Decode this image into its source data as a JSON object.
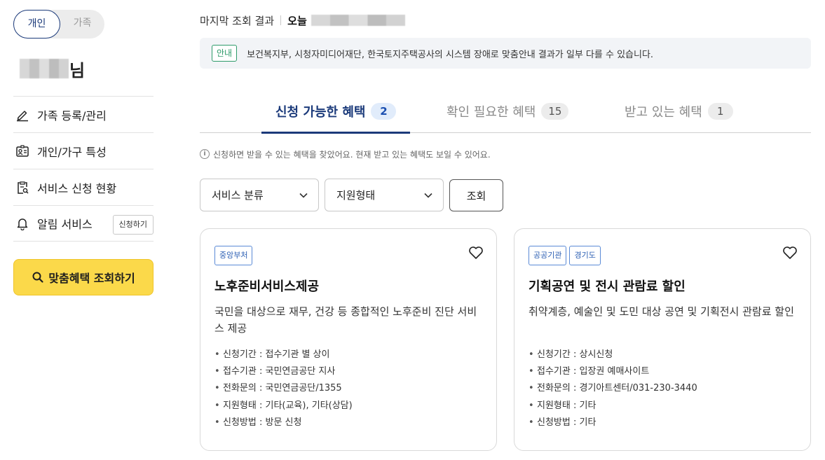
{
  "sidebar": {
    "toggle": {
      "personal": "개인",
      "family": "가족"
    },
    "user_suffix": "님",
    "menu": [
      {
        "label": "가족 등록/관리",
        "icon": "edit-pen-icon"
      },
      {
        "label": "개인/가구 특성",
        "icon": "id-card-icon"
      },
      {
        "label": "서비스 신청 현황",
        "icon": "clipboard-search-icon"
      },
      {
        "label": "알림 서비스",
        "icon": "bell-icon",
        "button": "신청하기"
      }
    ],
    "search_button": "맞춤혜택 조회하기"
  },
  "header": {
    "last_result": "마지막 조회 결과",
    "today": "오늘"
  },
  "notice": {
    "tag": "안내",
    "text": "보건복지부, 시청자미디어재단, 한국토지주택공사의 시스템 장애로 맞춤안내 결과가 일부 다를 수 있습니다."
  },
  "tabs": [
    {
      "label": "신청 가능한 혜택",
      "count": "2",
      "active": true
    },
    {
      "label": "확인 필요한 혜택",
      "count": "15",
      "active": false
    },
    {
      "label": "받고 있는 혜택",
      "count": "1",
      "active": false
    }
  ],
  "hint": "신청하면 받을 수 있는 혜택을 찾았어요. 현재 받고 있는 혜택도 보일 수 있어요.",
  "filters": {
    "category": "서비스 분류",
    "support_type": "지원형태",
    "query_button": "조회"
  },
  "cards": [
    {
      "badges": [
        "중앙부처"
      ],
      "title": "노후준비서비스제공",
      "desc": "국민을 대상으로 재무, 건강 등 종합적인 노후준비 진단 서비스 제공",
      "details": [
        "신청기간 : 접수기관 별 상이",
        "접수기관 : 국민연금공단 지사",
        "전화문의 : 국민연금공단/1355",
        "지원형태 : 기타(교육), 기타(상담)",
        "신청방법 : 방문 신청"
      ]
    },
    {
      "badges": [
        "공공기관",
        "경기도"
      ],
      "title": "기획공연 및 전시 관람료 할인",
      "desc": "취약계층, 예술인 및 도민 대상 공연 및 기획전시 관람료 할인",
      "details": [
        "신청기간 : 상시신청",
        "접수기관 : 입장권 예매사이트",
        "전화문의 : 경기아트센터/031-230-3440",
        "지원형태 : 기타",
        "신청방법 : 기타"
      ]
    }
  ],
  "colors": {
    "primary": "#1b3a7a",
    "accent_yellow": "#fbd94a",
    "notice_green": "#2e9b6a",
    "badge_blue": "#2c5fb3"
  }
}
